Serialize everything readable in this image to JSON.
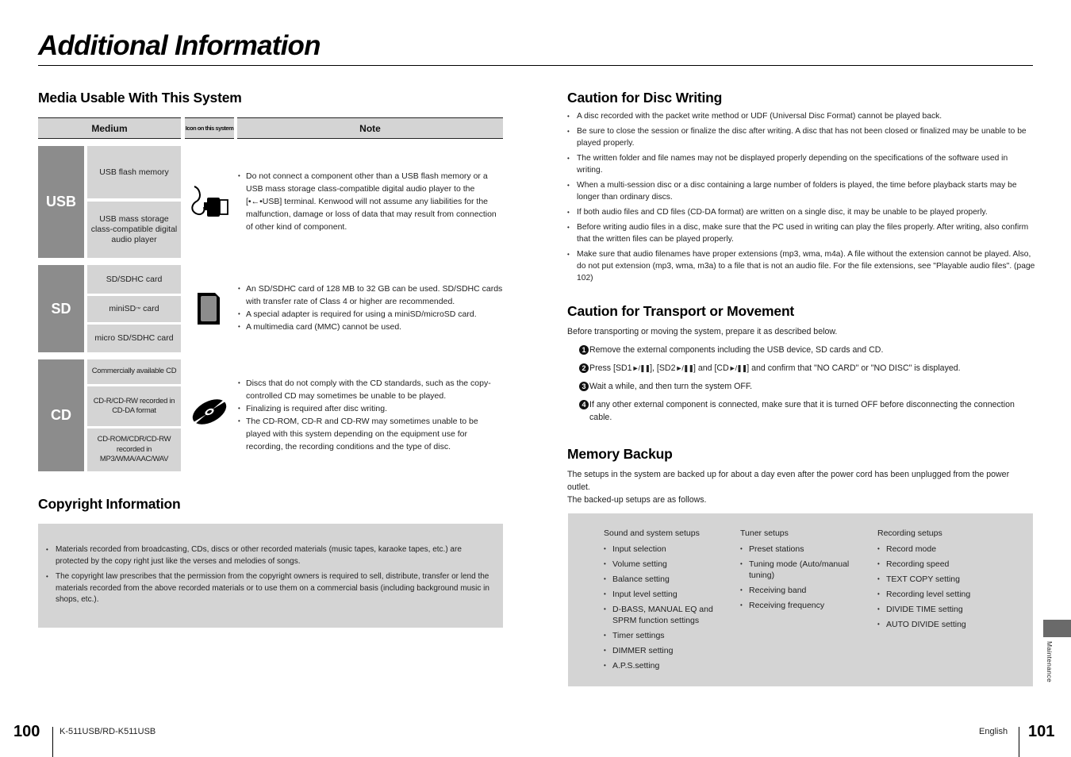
{
  "page": {
    "title": "Additional Information"
  },
  "media": {
    "heading": "Media Usable With This System",
    "headers": {
      "medium": "Medium",
      "icon": "Icon on this system",
      "note": "Note"
    },
    "usb": {
      "label": "USB",
      "items": [
        "USB flash memory",
        "USB mass storage class-compatible digital audio player"
      ],
      "icon": "usb-connector-icon",
      "notes": [
        "Do not connect a component other than a USB flash memory or a USB mass storage class-compatible digital audio player to the [",
        "USB] terminal. Kenwood will not assume any liabilities for the malfunction, damage or loss of data that may result from connection of other kind of component."
      ]
    },
    "sd": {
      "label": "SD",
      "items": [
        "SD/SDHC card",
        "miniSD",
        "card",
        "micro SD/SDHC card"
      ],
      "tm": "™",
      "icon": "sd-card-icon",
      "notes": [
        "An SD/SDHC card of 128 MB to 32 GB can be used. SD/SDHC cards with transfer rate of Class 4 or higher are recommended.",
        "A special adapter is required for using a miniSD/microSD card.",
        "A multimedia card (MMC) cannot be used."
      ]
    },
    "cd": {
      "label": "CD",
      "items": [
        "Commercially available CD",
        "CD-R/CD-RW recorded in CD-DA format",
        "CD-ROM/CDR/CD-RW recorded in MP3/WMA/AAC/WAV"
      ],
      "icon": "disc-icon",
      "notes": [
        "Discs that do not comply with the CD standards, such as the copy-controlled CD may sometimes be unable to be played.",
        "Finalizing is required after disc writing.",
        "The CD-ROM, CD-R and CD-RW may sometimes unable to be played with this system depending on the equipment use for recording, the recording conditions and the type of disc."
      ]
    }
  },
  "copyright": {
    "heading": "Copyright Information",
    "items": [
      "Materials recorded from broadcasting, CDs, discs or other recorded materials (music tapes, karaoke tapes, etc.) are protected by the copy right just like the verses and melodies of songs.",
      "The copyright law prescribes that the permission from the copyright owners is required to sell, distribute, transfer or lend the materials recorded from the above recorded materials or to use them on a commercial basis (including background music in shops, etc.)."
    ]
  },
  "disc_writing": {
    "heading": "Caution for Disc Writing",
    "items": [
      "A disc recorded with the packet write method or UDF (Universal Disc Format) cannot be played back.",
      "Be sure to close the session or finalize the disc after writing. A disc that has not been closed or finalized may be unable to be played properly.",
      "The written folder and file names may not be displayed properly depending on the specifications of the software used in writing.",
      "When a multi-session disc or a disc containing a large number of folders is played, the time before playback starts may be longer than ordinary discs.",
      "If both audio files and CD files (CD-DA format) are written on a single disc, it may be unable to be played properly.",
      "Before writing audio files in a disc, make sure that the PC used in writing can play the files properly. After writing, also confirm that the written files can be played properly.",
      "Make sure that audio filenames have proper extensions (mp3, wma, m4a). A file without the extension cannot be played. Also, do not put extension (mp3, wma, m3a) to a file that is not an audio file. For the file extensions, see \"Playable audio files\". (page 102)"
    ]
  },
  "transport": {
    "heading": "Caution for Transport or Movement",
    "intro": "Before transporting or moving the system, prepare it as described below.",
    "steps": [
      {
        "num": "1",
        "text": "Remove the external components including the USB device, SD cards and CD."
      },
      {
        "num": "2",
        "parts": [
          "Press [SD1",
          "], [SD2",
          "] and [CD",
          "] and confirm that \"NO CARD\" or \"NO DISC\" is displayed."
        ],
        "play_pause": "►/❚❚"
      },
      {
        "num": "3",
        "text": "Wait a while, and then turn the system OFF."
      },
      {
        "num": "4",
        "text": "If any other external component is connected, make sure that it is turned OFF before disconnecting the connection cable."
      }
    ]
  },
  "memory": {
    "heading": "Memory Backup",
    "intro1": "The setups in the system are backed up for about a day even after the power cord has been unplugged from the power outlet.",
    "intro2": "The backed-up setups are as follows.",
    "columns": [
      {
        "title": "Sound and system setups",
        "items": [
          "Input selection",
          "Volume setting",
          "Balance setting",
          "Input level setting",
          "D-BASS, MANUAL EQ and SPRM function settings",
          "Timer settings",
          "DIMMER setting",
          "A.P.S.setting"
        ]
      },
      {
        "title": "Tuner setups",
        "items": [
          "Preset stations",
          "Tuning mode (Auto/manual tuning)",
          "Receiving band",
          "Receiving frequency"
        ]
      },
      {
        "title": "Recording setups",
        "items": [
          "Record mode",
          "Recording speed",
          "TEXT COPY setting",
          "Recording level setting",
          "DIVIDE TIME setting",
          "AUTO DIVIDE setting"
        ]
      }
    ]
  },
  "side_tab": {
    "label": "Maintenance"
  },
  "footer": {
    "left_page": "100",
    "model": "K-511USB/RD-K511USB",
    "language": "English",
    "right_page": "101"
  }
}
